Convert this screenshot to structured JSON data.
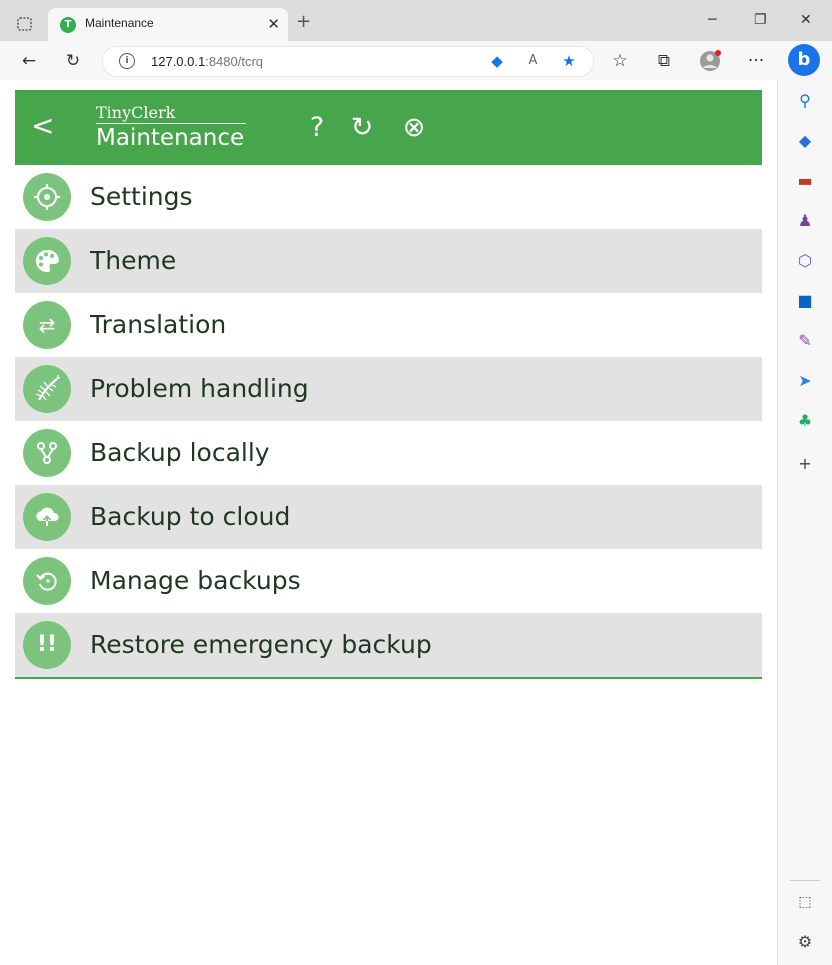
{
  "browser": {
    "tab_title": "Maintenance",
    "tab_favicon_letter": "T",
    "tab_close": "✕",
    "new_tab": "+",
    "window_buttons": [
      "─",
      "❐",
      "✕"
    ],
    "url_host": "127.0.0.1",
    "url_rest": ":8480/tcrq",
    "toolbar_more": "···"
  },
  "app": {
    "name": "TinyClerk",
    "page_title": "Maintenance",
    "back_label": "<",
    "help_label": "?",
    "refresh_label": "↻",
    "close_label": "⊗",
    "accent_color": "#47a54b",
    "icon_color": "#7cc47e"
  },
  "menu": {
    "items": [
      {
        "label": "Settings",
        "icon": "settings-icon"
      },
      {
        "label": "Theme",
        "icon": "palette-icon"
      },
      {
        "label": "Translation",
        "icon": "translate-icon"
      },
      {
        "label": "Problem handling",
        "icon": "bug-icon"
      },
      {
        "label": "Backup locally",
        "icon": "branch-icon"
      },
      {
        "label": "Backup to cloud",
        "icon": "cloud-upload-icon"
      },
      {
        "label": "Manage backups",
        "icon": "history-icon"
      },
      {
        "label": "Restore emergency backup",
        "icon": "emergency-icon"
      }
    ]
  }
}
